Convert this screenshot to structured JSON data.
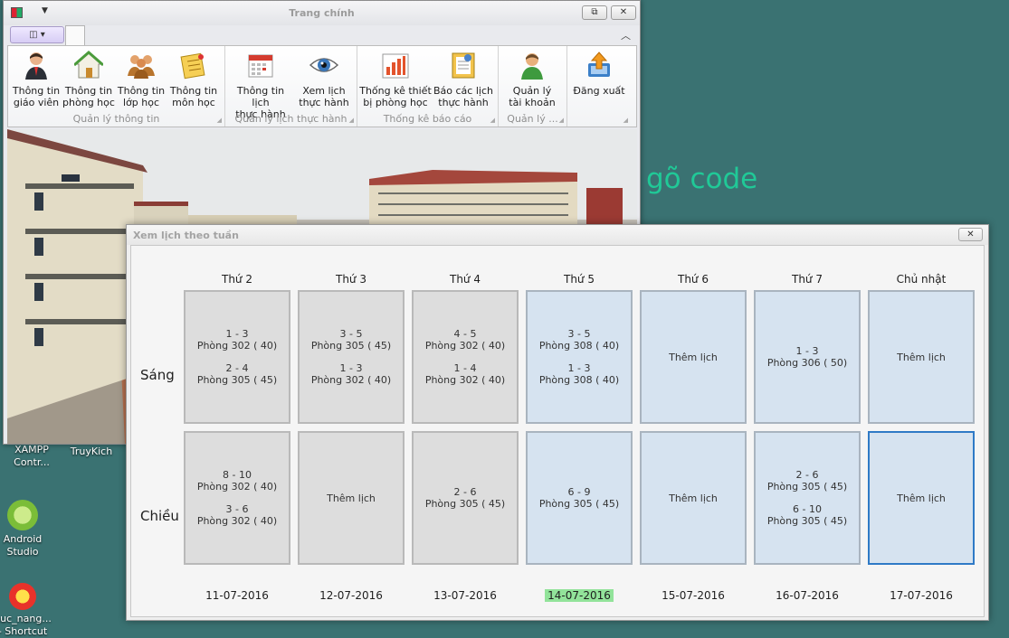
{
  "desktop": {
    "watermark": "gõ code",
    "icons": [
      {
        "label": "XAMPP\nContr...",
        "name": "xampp"
      },
      {
        "label": "TruyKich",
        "name": "truykich"
      },
      {
        "label": "Android\nStudio",
        "name": "android-studio"
      },
      {
        "label": "huc_nang...\n- Shortcut",
        "name": "shortcut"
      }
    ]
  },
  "main_window": {
    "title": "Trang chính",
    "groups": [
      {
        "caption": "Quản lý thông tin",
        "buttons": [
          {
            "label": "Thông tin\ngiáo viên",
            "icon": "teacher-icon"
          },
          {
            "label": "Thông tin\nphòng học",
            "icon": "house-icon"
          },
          {
            "label": "Thông tin\nlớp học",
            "icon": "group-icon"
          },
          {
            "label": "Thông tin\nmôn học",
            "icon": "notes-icon"
          }
        ]
      },
      {
        "caption": "Quản lý lịch thực hành",
        "buttons": [
          {
            "label": "Thông tin lịch\nthực hành",
            "icon": "calendar-icon"
          },
          {
            "label": "Xem lịch\nthực hành",
            "icon": "eye-icon"
          }
        ]
      },
      {
        "caption": "Thống kê báo cáo",
        "buttons": [
          {
            "label": "Thống kê thiết\nbị phòng học",
            "icon": "bar-chart-icon"
          },
          {
            "label": "Báo các lịch\nthực hành",
            "icon": "clipboard-icon"
          }
        ]
      },
      {
        "caption": "Quản lý ...",
        "buttons": [
          {
            "label": "Quản lý\ntài khoản",
            "icon": "user-icon"
          }
        ]
      },
      {
        "caption": "",
        "buttons": [
          {
            "label": "Đăng xuất",
            "icon": "logout-icon"
          }
        ]
      }
    ]
  },
  "schedule": {
    "title": "Xem lịch theo tuần",
    "rows": [
      "Sáng",
      "Chiều"
    ],
    "add_label": "Thêm lịch",
    "days": [
      {
        "name": "Thứ 2",
        "date": "11-07-2016",
        "state": "past",
        "morning": [
          {
            "periods": "1 - 3",
            "room": "Phòng 302 ( 40)"
          },
          {
            "periods": "2 - 4",
            "room": "Phòng 305 ( 45)"
          }
        ],
        "afternoon": [
          {
            "periods": "8 - 10",
            "room": "Phòng 302 ( 40)"
          },
          {
            "periods": "3 - 6",
            "room": "Phòng 302 ( 40)"
          }
        ]
      },
      {
        "name": "Thứ 3",
        "date": "12-07-2016",
        "state": "past",
        "morning": [
          {
            "periods": "3 - 5",
            "room": "Phòng 305 ( 45)"
          },
          {
            "periods": "1 - 3",
            "room": "Phòng 302 ( 40)"
          }
        ],
        "afternoon": []
      },
      {
        "name": "Thứ 4",
        "date": "13-07-2016",
        "state": "past",
        "morning": [
          {
            "periods": "4 - 5",
            "room": "Phòng 302 ( 40)"
          },
          {
            "periods": "1 - 4",
            "room": "Phòng 302 ( 40)"
          }
        ],
        "afternoon": [
          {
            "periods": "2 - 6",
            "room": "Phòng 305 ( 45)"
          }
        ]
      },
      {
        "name": "Thứ 5",
        "date": "14-07-2016",
        "state": "today",
        "morning": [
          {
            "periods": "3 - 5",
            "room": "Phòng 308 ( 40)"
          },
          {
            "periods": "1 - 3",
            "room": "Phòng 308 ( 40)"
          }
        ],
        "afternoon": [
          {
            "periods": "6 - 9",
            "room": "Phòng 305 ( 45)"
          }
        ]
      },
      {
        "name": "Thứ 6",
        "date": "15-07-2016",
        "state": "future",
        "morning": [],
        "afternoon": []
      },
      {
        "name": "Thứ 7",
        "date": "16-07-2016",
        "state": "future",
        "morning": [
          {
            "periods": "1 - 3",
            "room": "Phòng 306 ( 50)"
          }
        ],
        "afternoon": [
          {
            "periods": "2 - 6",
            "room": "Phòng 305 ( 45)"
          },
          {
            "periods": "6 - 10",
            "room": "Phòng 305 ( 45)"
          }
        ]
      },
      {
        "name": "Chủ nhật",
        "date": "17-07-2016",
        "state": "future",
        "morning": [],
        "afternoon": []
      }
    ],
    "selected": {
      "day": 6,
      "row": "afternoon"
    },
    "colors": {
      "past": "#dddddd",
      "future": "#d6e3f0",
      "today_date": "#92e39a",
      "selected_border": "#2f7ac6"
    }
  }
}
